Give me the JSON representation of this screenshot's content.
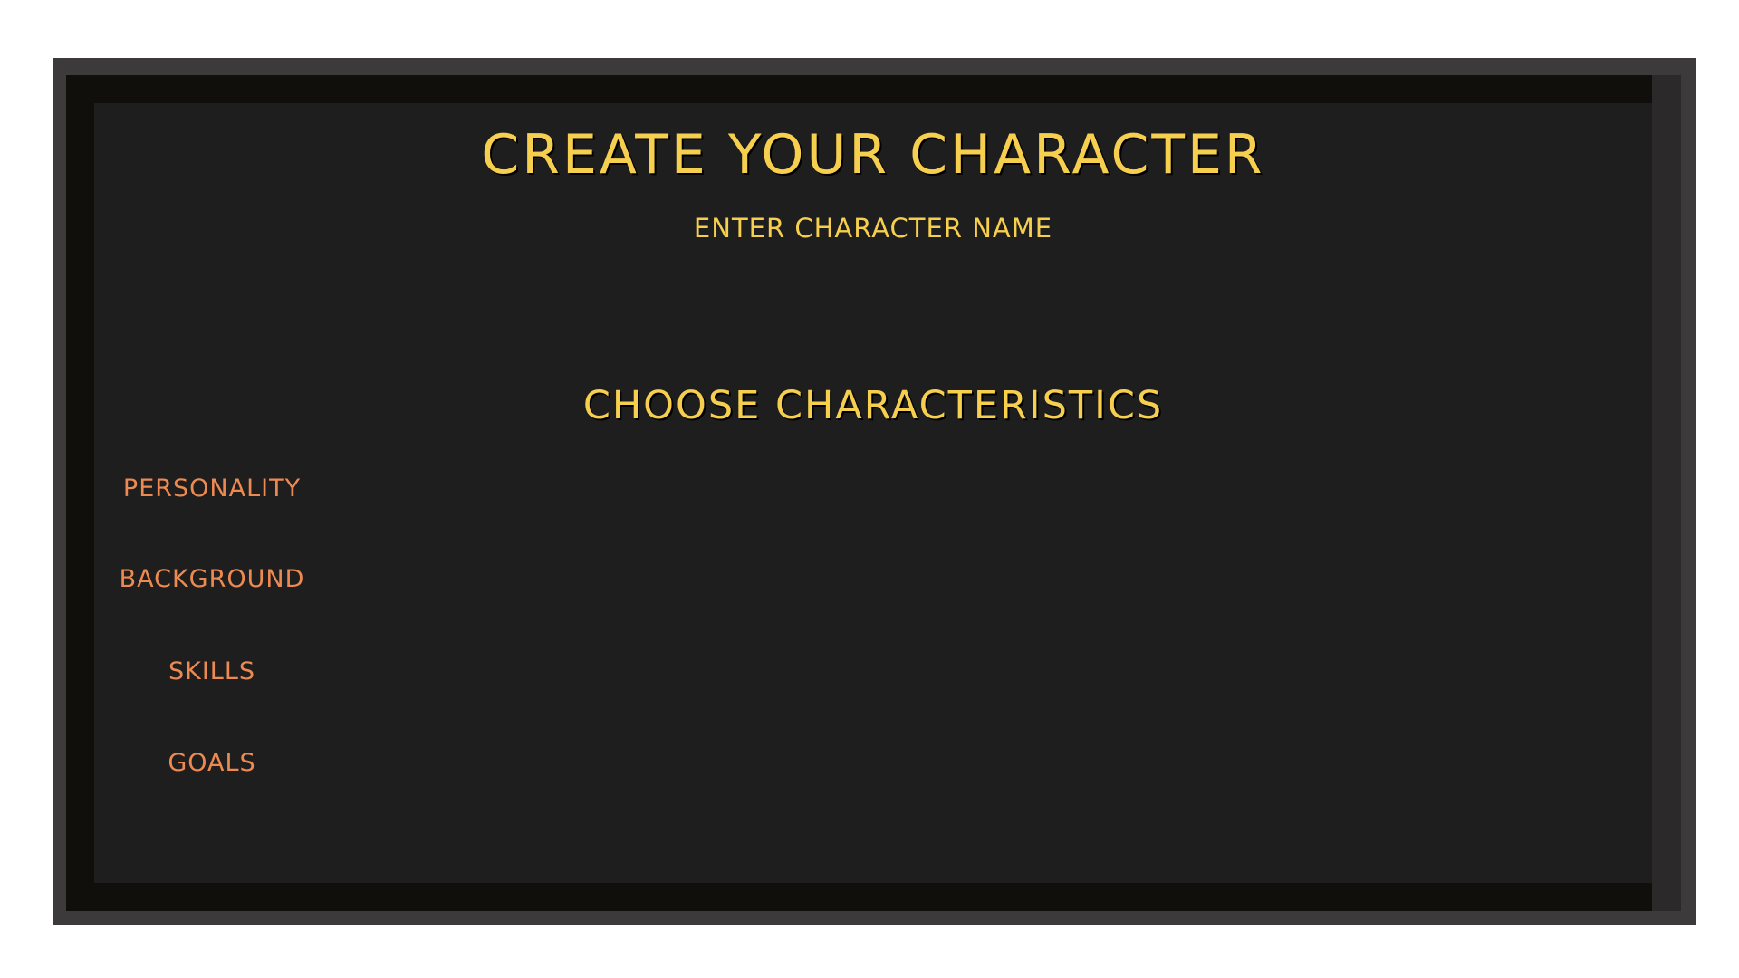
{
  "screen": {
    "title": "CREATE YOUR CHARACTER",
    "name_prompt": "ENTER CHARACTER NAME",
    "section_title": "CHOOSE CHARACTERISTICS"
  },
  "characteristics": [
    {
      "label": "PERSONALITY"
    },
    {
      "label": "BACKGROUND"
    },
    {
      "label": "SKILLS"
    },
    {
      "label": "GOALS"
    }
  ],
  "colors": {
    "title": "#f7cf4f",
    "menu_item": "#ec8a52",
    "panel_background": "#1e1e1e",
    "frame": "#3d3a3b"
  }
}
